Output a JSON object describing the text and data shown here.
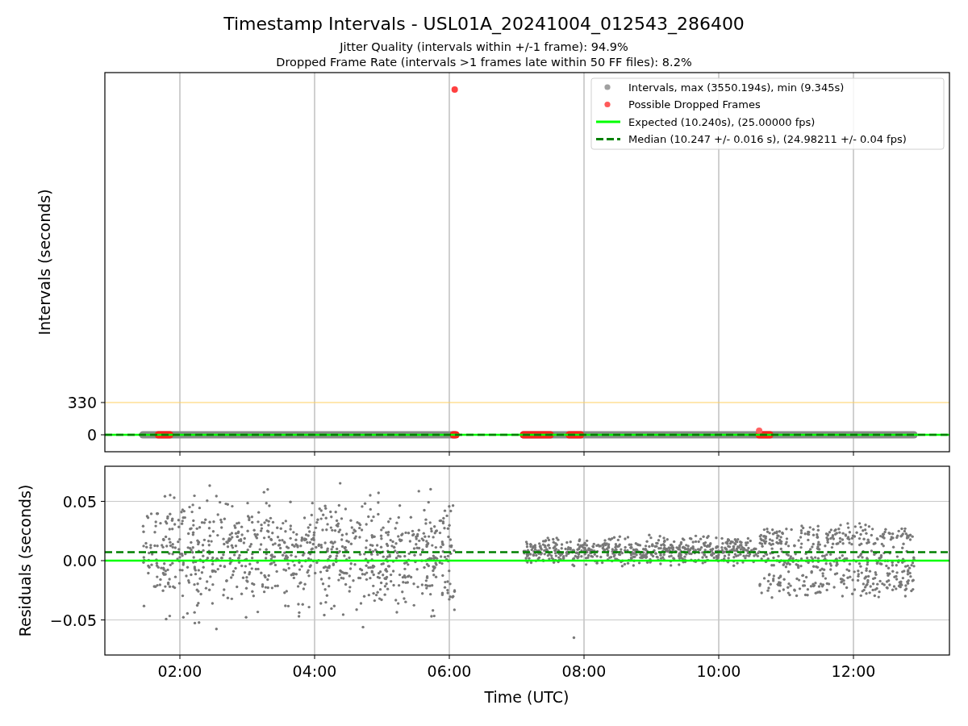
{
  "title": "Timestamp Intervals - USL01A_20241004_012543_286400",
  "subtitles": [
    "Jitter Quality (intervals within +/-1 frame): 94.9%",
    "Dropped Frame Rate (intervals >1 frames late within 50 FF files): 8.2%"
  ],
  "intervals_panel": {
    "ylabel": "Intervals (seconds)",
    "yticks": [
      {
        "label": "330"
      },
      {
        "label": "0"
      }
    ],
    "legend": [
      {
        "kind": "dot",
        "color": "#a0a0a0",
        "label": "Intervals, max (3550.194s), min (9.345s)"
      },
      {
        "kind": "dot",
        "color": "#ff5a5a",
        "label": "Possible Dropped Frames"
      },
      {
        "kind": "line",
        "color": "#00ff00",
        "label": "Expected (10.240s), (25.00000 fps)"
      },
      {
        "kind": "dashed",
        "color": "#008000",
        "label": "Median (10.247 +/- 0.016 s), (24.98211 +/- 0.04 fps)"
      }
    ]
  },
  "residuals_panel": {
    "ylabel": "Residuals (seconds)",
    "yticks": [
      {
        "label": "0.05"
      },
      {
        "label": "0.00"
      },
      {
        "label": "−0.05"
      }
    ],
    "xticks": [
      {
        "label": "02:00"
      },
      {
        "label": "04:00"
      },
      {
        "label": "06:00"
      },
      {
        "label": "08:00"
      },
      {
        "label": "10:00"
      },
      {
        "label": "12:00"
      }
    ],
    "xlabel": "Time (UTC)"
  }
}
